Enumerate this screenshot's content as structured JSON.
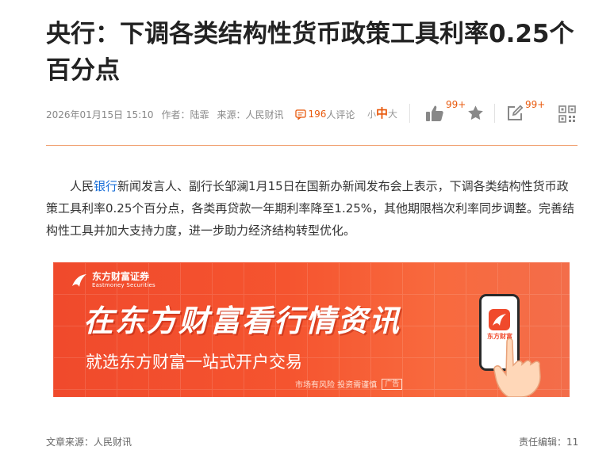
{
  "article": {
    "title": "央行：下调各类结构性货币政策工具利率0.25个百分点",
    "meta": {
      "datetime": "2026年01月15日 15:10",
      "author_label": "作者：陆霏",
      "source_label": "来源：人民财讯",
      "comment_count": "196",
      "comment_word": "人评论"
    },
    "font_size": {
      "small": "小",
      "medium": "中",
      "large": "大"
    },
    "actions": {
      "like_count": "99+",
      "edit_count": "99+",
      "icons": [
        "thumbs-up-icon",
        "star-icon",
        "edit-icon",
        "qr-code-icon"
      ]
    },
    "body": {
      "part1": "人民",
      "link": "银行",
      "part2": "新闻发言人、副行长邹澜1月15日在国新办新闻发布会上表示，下调各类结构性货币政策工具利率0.25个百分点，各类再贷款一年期利率降至1.25%，其他期限档次利率同步调整。完善结构性工具并加大支持力度，进一步助力经济结构转型优化。"
    },
    "footer": {
      "source": "文章来源：人民财讯",
      "editor": "责任编辑：11"
    }
  },
  "ad": {
    "brand_cn": "东方财富证券",
    "brand_en": "Eastmoney Securities",
    "headline": "在东方财富看行情资讯",
    "subline": "就选东方财富一站式开户交易",
    "risk": "市场有风险 投资需谨慎",
    "tag": "广告",
    "phone_app_label": "东方财富"
  },
  "colors": {
    "accent": "#e8590c",
    "link": "#1a6fd8",
    "ad_red": "#f04a2c",
    "divider": "#f0a070"
  }
}
